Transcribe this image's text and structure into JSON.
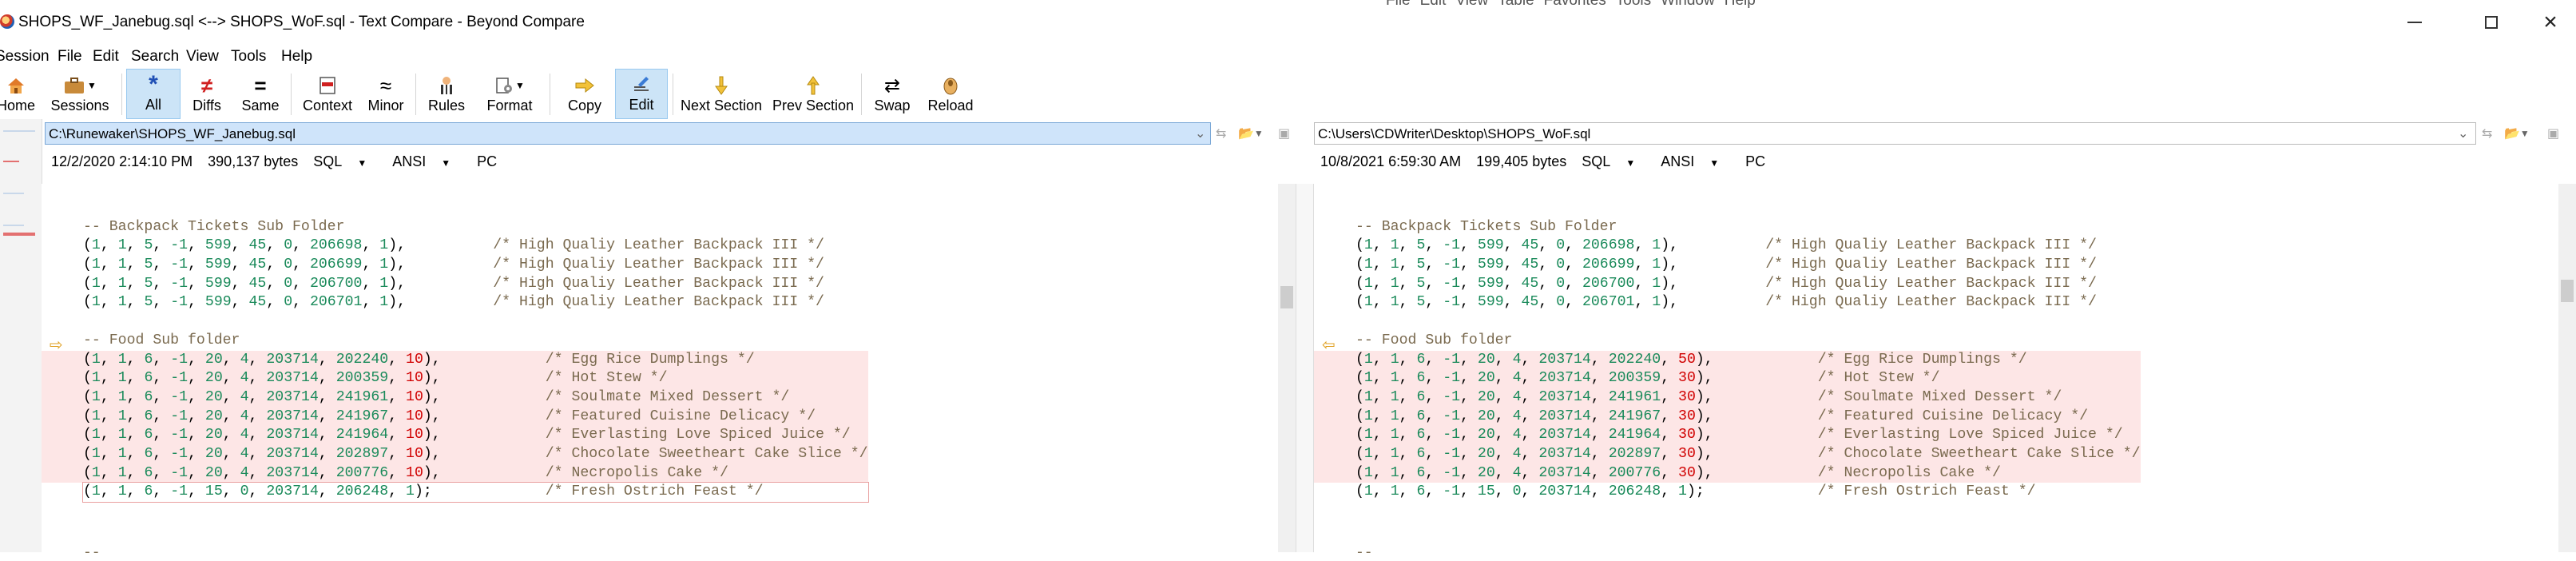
{
  "window": {
    "title": "SHOPS_WF_Janebug.sql <--> SHOPS_WoF.sql - Text Compare - Beyond Compare",
    "background_menu": [
      "File",
      "Edit",
      "View",
      "Table",
      "Favorites",
      "Tools",
      "Window",
      "Help"
    ]
  },
  "menu": [
    "Session",
    "File",
    "Edit",
    "Search",
    "View",
    "Tools",
    "Help"
  ],
  "toolbar": {
    "home": "Home",
    "sessions": "Sessions",
    "all": "All",
    "diffs": "Diffs",
    "same": "Same",
    "context": "Context",
    "minor": "Minor",
    "rules": "Rules",
    "format": "Format",
    "copy": "Copy",
    "edit": "Edit",
    "next_section": "Next Section",
    "prev_section": "Prev Section",
    "swap": "Swap",
    "reload": "Reload"
  },
  "left": {
    "path": "C:\\Runewaker\\SHOPS_WF_Janebug.sql",
    "date": "12/2/2020 2:14:10 PM",
    "size": "390,137 bytes",
    "format": "SQL",
    "encoding": "ANSI",
    "line_endings": "PC",
    "lines": [
      {
        "t": "",
        "kind": "blank"
      },
      {
        "t": "-- Backpack Tickets Sub Folder",
        "kind": "comment"
      },
      {
        "t": "(1, 1, 5, -1, 599, 45, 0, 206698, 1),          /* High Qualiy Leather Backpack III */",
        "kind": "code"
      },
      {
        "t": "(1, 1, 5, -1, 599, 45, 0, 206699, 1),          /* High Qualiy Leather Backpack III */",
        "kind": "code"
      },
      {
        "t": "(1, 1, 5, -1, 599, 45, 0, 206700, 1),          /* High Qualiy Leather Backpack III */",
        "kind": "code"
      },
      {
        "t": "(1, 1, 5, -1, 599, 45, 0, 206701, 1),          /* High Qualiy Leather Backpack III */",
        "kind": "code"
      },
      {
        "t": "",
        "kind": "blank"
      },
      {
        "t": "-- Food Sub folder",
        "kind": "comment"
      },
      {
        "t": "(1, 1, 6, -1, 20, 4, 203714, 202240, 10),            /* Egg Rice Dumplings */",
        "kind": "diff"
      },
      {
        "t": "(1, 1, 6, -1, 20, 4, 203714, 200359, 10),            /* Hot Stew */",
        "kind": "diff"
      },
      {
        "t": "(1, 1, 6, -1, 20, 4, 203714, 241961, 10),            /* Soulmate Mixed Dessert */",
        "kind": "diff"
      },
      {
        "t": "(1, 1, 6, -1, 20, 4, 203714, 241967, 10),            /* Featured Cuisine Delicacy */",
        "kind": "diff"
      },
      {
        "t": "(1, 1, 6, -1, 20, 4, 203714, 241964, 10),            /* Everlasting Love Spiced Juice */",
        "kind": "diff"
      },
      {
        "t": "(1, 1, 6, -1, 20, 4, 203714, 202897, 10),            /* Chocolate Sweetheart Cake Slice */",
        "kind": "diff"
      },
      {
        "t": "(1, 1, 6, -1, 20, 4, 203714, 200776, 10),            /* Necropolis Cake */",
        "kind": "diff"
      },
      {
        "t": "(1, 1, 6, -1, 15, 0, 203714, 206248, 1);             /* Fresh Ostrich Feast */",
        "kind": "cursor"
      }
    ]
  },
  "right": {
    "path": "C:\\Users\\CDWriter\\Desktop\\SHOPS_WoF.sql",
    "date": "10/8/2021 6:59:30 AM",
    "size": "199,405 bytes",
    "format": "SQL",
    "encoding": "ANSI",
    "line_endings": "PC",
    "lines": [
      {
        "t": "",
        "kind": "blank"
      },
      {
        "t": "-- Backpack Tickets Sub Folder",
        "kind": "comment"
      },
      {
        "t": "(1, 1, 5, -1, 599, 45, 0, 206698, 1),          /* High Qualiy Leather Backpack III */",
        "kind": "code"
      },
      {
        "t": "(1, 1, 5, -1, 599, 45, 0, 206699, 1),          /* High Qualiy Leather Backpack III */",
        "kind": "code"
      },
      {
        "t": "(1, 1, 5, -1, 599, 45, 0, 206700, 1),          /* High Qualiy Leather Backpack III */",
        "kind": "code"
      },
      {
        "t": "(1, 1, 5, -1, 599, 45, 0, 206701, 1),          /* High Qualiy Leather Backpack III */",
        "kind": "code"
      },
      {
        "t": "",
        "kind": "blank"
      },
      {
        "t": "-- Food Sub folder",
        "kind": "comment"
      },
      {
        "t": "(1, 1, 6, -1, 20, 4, 203714, 202240, 50),            /* Egg Rice Dumplings */",
        "kind": "diff"
      },
      {
        "t": "(1, 1, 6, -1, 20, 4, 203714, 200359, 30),            /* Hot Stew */",
        "kind": "diff"
      },
      {
        "t": "(1, 1, 6, -1, 20, 4, 203714, 241961, 30),            /* Soulmate Mixed Dessert */",
        "kind": "diff"
      },
      {
        "t": "(1, 1, 6, -1, 20, 4, 203714, 241967, 30),            /* Featured Cuisine Delicacy */",
        "kind": "diff"
      },
      {
        "t": "(1, 1, 6, -1, 20, 4, 203714, 241964, 30),            /* Everlasting Love Spiced Juice */",
        "kind": "diff"
      },
      {
        "t": "(1, 1, 6, -1, 20, 4, 203714, 202897, 30),            /* Chocolate Sweetheart Cake Slice */",
        "kind": "diff"
      },
      {
        "t": "(1, 1, 6, -1, 20, 4, 203714, 200776, 30),            /* Necropolis Cake */",
        "kind": "diff"
      },
      {
        "t": "(1, 1, 6, -1, 15, 0, 203714, 206248, 1);             /* Fresh Ostrich Feast */",
        "kind": "code"
      }
    ]
  },
  "footer_left": "--",
  "footer_right": "--",
  "colors": {
    "diff_bg": "#fde6e6",
    "diff_text": "#d00000",
    "number": "#1a8a5a",
    "comment": "#7a6a4f",
    "path_active": "#cfe4fa",
    "toolbar_active": "#cce4f7"
  }
}
